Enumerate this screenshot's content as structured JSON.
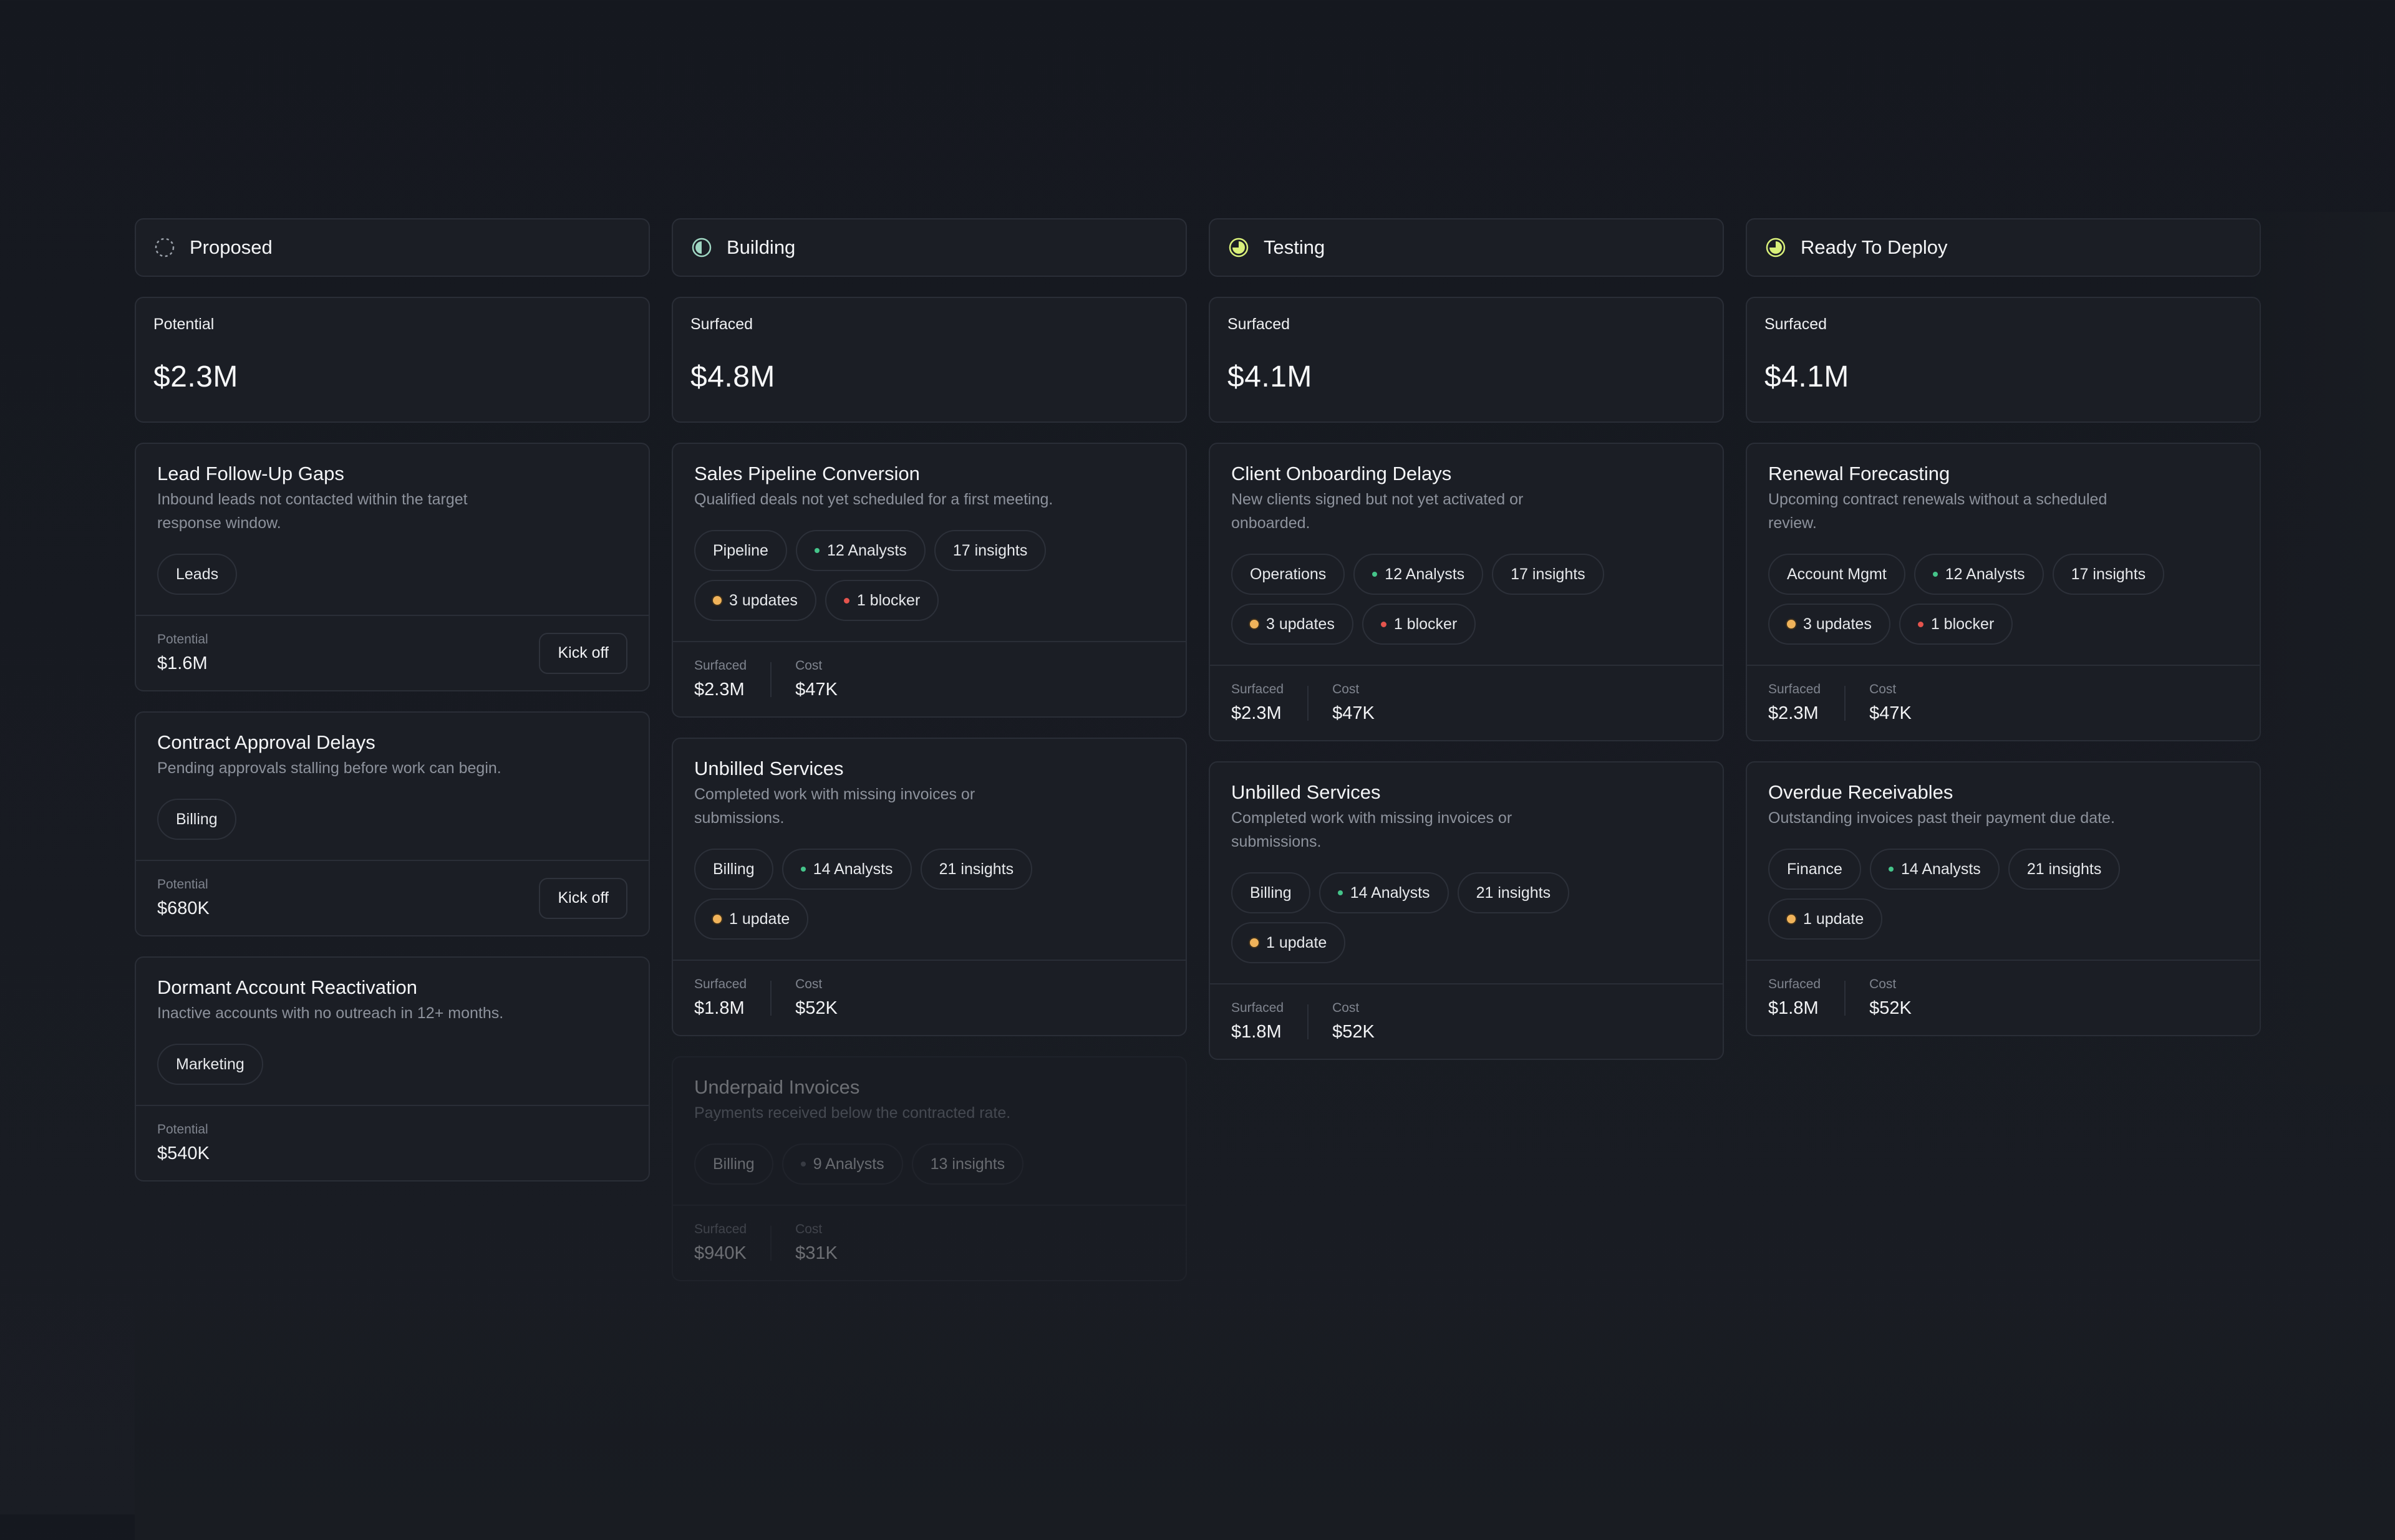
{
  "columns": [
    {
      "title": "Proposed",
      "icon": "dashed-circle-icon",
      "summary": {
        "label": "Potential",
        "value": "$2.3M"
      },
      "cards": [
        {
          "title": "Lead Follow-Up Gaps",
          "description": "Inbound leads not contacted within the target response window.",
          "chips": [
            "Leads"
          ],
          "footer": {
            "label": "Potential",
            "value": "$1.6M",
            "action": "Kick off"
          }
        },
        {
          "title": "Contract Approval Delays",
          "description": "Pending approvals stalling before work can begin.",
          "chips": [
            "Billing"
          ],
          "footer": {
            "label": "Potential",
            "value": "$680K",
            "action": "Kick off"
          }
        },
        {
          "title": "Dormant Account Reactivation",
          "description": "Inactive accounts with no outreach in 12+ months.",
          "chips": [
            "Marketing"
          ],
          "footer": {
            "label": "Potential",
            "value": "$540K"
          }
        }
      ]
    },
    {
      "title": "Building",
      "icon": "half-circle-icon",
      "summary": {
        "label": "Surfaced",
        "value": "$4.8M"
      },
      "cards": [
        {
          "title": "Sales Pipeline Conversion",
          "description": "Qualified deals not yet scheduled for a first meeting.",
          "chips": [
            "Pipeline",
            "12 Analysts",
            "17 insights",
            "3 updates",
            "1 blocker"
          ],
          "footer": {
            "surfaced_label": "Surfaced",
            "surfaced": "$2.3M",
            "cost_label": "Cost",
            "cost": "$47K"
          }
        },
        {
          "title": "Unbilled Services",
          "description": "Completed work with missing invoices or submissions.",
          "chips": [
            "Billing",
            "14 Analysts",
            "21 insights",
            "1 update"
          ],
          "footer": {
            "surfaced_label": "Surfaced",
            "surfaced": "$1.8M",
            "cost_label": "Cost",
            "cost": "$52K"
          }
        },
        {
          "title": "Underpaid Invoices",
          "description": "Payments received below the contracted rate.",
          "chips": [
            "Billing",
            "9 Analysts",
            "13 insights"
          ],
          "footer": {
            "surfaced_label": "Surfaced",
            "surfaced": "$940K",
            "cost_label": "Cost",
            "cost": "$31K"
          }
        }
      ]
    },
    {
      "title": "Testing",
      "icon": "three-quarter-circle-icon",
      "summary": {
        "label": "Surfaced",
        "value": "$4.1M"
      },
      "cards": [
        {
          "title": "Client Onboarding Delays",
          "description": "New clients signed but not yet activated or onboarded.",
          "chips": [
            "Operations",
            "12 Analysts",
            "17 insights",
            "3 updates",
            "1 blocker"
          ],
          "footer": {
            "surfaced_label": "Surfaced",
            "surfaced": "$2.3M",
            "cost_label": "Cost",
            "cost": "$47K"
          }
        },
        {
          "title": "Unbilled Services",
          "description": "Completed work with missing invoices or submissions.",
          "chips": [
            "Billing",
            "14 Analysts",
            "21 insights",
            "1 update"
          ],
          "footer": {
            "surfaced_label": "Surfaced",
            "surfaced": "$1.8M",
            "cost_label": "Cost",
            "cost": "$52K"
          }
        }
      ]
    },
    {
      "title": "Ready To Deploy",
      "icon": "three-quarter-circle-icon",
      "summary": {
        "label": "Surfaced",
        "value": "$4.1M"
      },
      "cards": [
        {
          "title": "Renewal Forecasting",
          "description": "Upcoming contract renewals without a scheduled review.",
          "chips": [
            "Account Mgmt",
            "12 Analysts",
            "17 insights",
            "3 updates",
            "1 blocker"
          ],
          "footer": {
            "surfaced_label": "Surfaced",
            "surfaced": "$2.3M",
            "cost_label": "Cost",
            "cost": "$47K"
          }
        },
        {
          "title": "Overdue Receivables",
          "description": "Outstanding invoices past their payment due date.",
          "chips": [
            "Finance",
            "14 Analysts",
            "21 insights",
            "1 update"
          ],
          "footer": {
            "surfaced_label": "Surfaced",
            "surfaced": "$1.8M",
            "cost_label": "Cost",
            "cost": "$52K"
          }
        }
      ]
    }
  ],
  "colors": {
    "background": "#181b21",
    "card": "#1b1e25",
    "border": "#2a2e37",
    "accent_green": "#45c48a",
    "accent_yellow": "#d9f07a",
    "update_orange": "#f0b35a",
    "blocker_red": "#e5544d"
  }
}
